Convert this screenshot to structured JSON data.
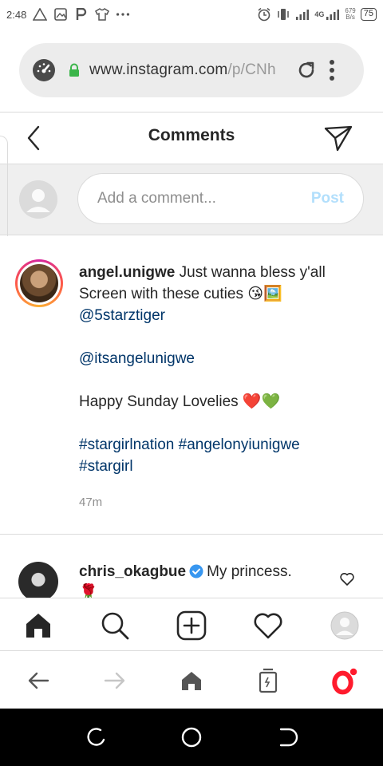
{
  "status_bar": {
    "time": "2:48",
    "network": "4G",
    "speed_value": "679",
    "speed_unit": "B/s",
    "battery": "75",
    "icons": [
      "triangle-warning-icon",
      "image-icon",
      "p-icon",
      "tshirt-icon",
      "more-dots-icon",
      "alarm-icon",
      "vibrate-icon",
      "signal-icon",
      "signal-icon"
    ]
  },
  "browser": {
    "url_host": "www.instagram.com",
    "url_path": "/p/CNh",
    "icons": [
      "speed-dial-icon",
      "lock-icon",
      "reload-icon",
      "kebab-menu-icon"
    ]
  },
  "header": {
    "title": "Comments",
    "icons": [
      "back-chevron-icon",
      "direct-send-icon"
    ]
  },
  "add_comment": {
    "placeholder": "Add a comment...",
    "post_label": "Post"
  },
  "caption": {
    "username": "angel.unigwe",
    "text_line1": " Just wanna bless y'all Screen with these cuties 😘🖼️",
    "mention1": "@5starztiger",
    "mention2": "@itsangelunigwe",
    "greeting": "Happy Sunday Lovelies ❤️💚",
    "hashtag1": "#stargirlnation",
    "hashtag2": "#angelonyiunigwe",
    "hashtag3": "#stargirl",
    "time": "47m"
  },
  "reply": {
    "username": "chris_okagbue",
    "text": "My princess.",
    "emoji": "🌹"
  },
  "ig_nav": {
    "icons": [
      "home-icon",
      "search-icon",
      "new-post-icon",
      "activity-heart-icon",
      "profile-avatar-icon"
    ]
  },
  "opera_bar": {
    "icons": [
      "back-arrow-icon",
      "forward-arrow-icon",
      "home-icon",
      "tabs-icon",
      "opera-logo-icon"
    ]
  },
  "system_nav": {
    "icons": [
      "recent-apps-icon",
      "home-circle-icon",
      "back-icon"
    ]
  },
  "colors": {
    "link": "#003569",
    "post_disabled": "#b2dffc",
    "verified": "#3897f0",
    "opera_red": "#ff1b2d",
    "notification_dot": "#ff1b2d"
  }
}
